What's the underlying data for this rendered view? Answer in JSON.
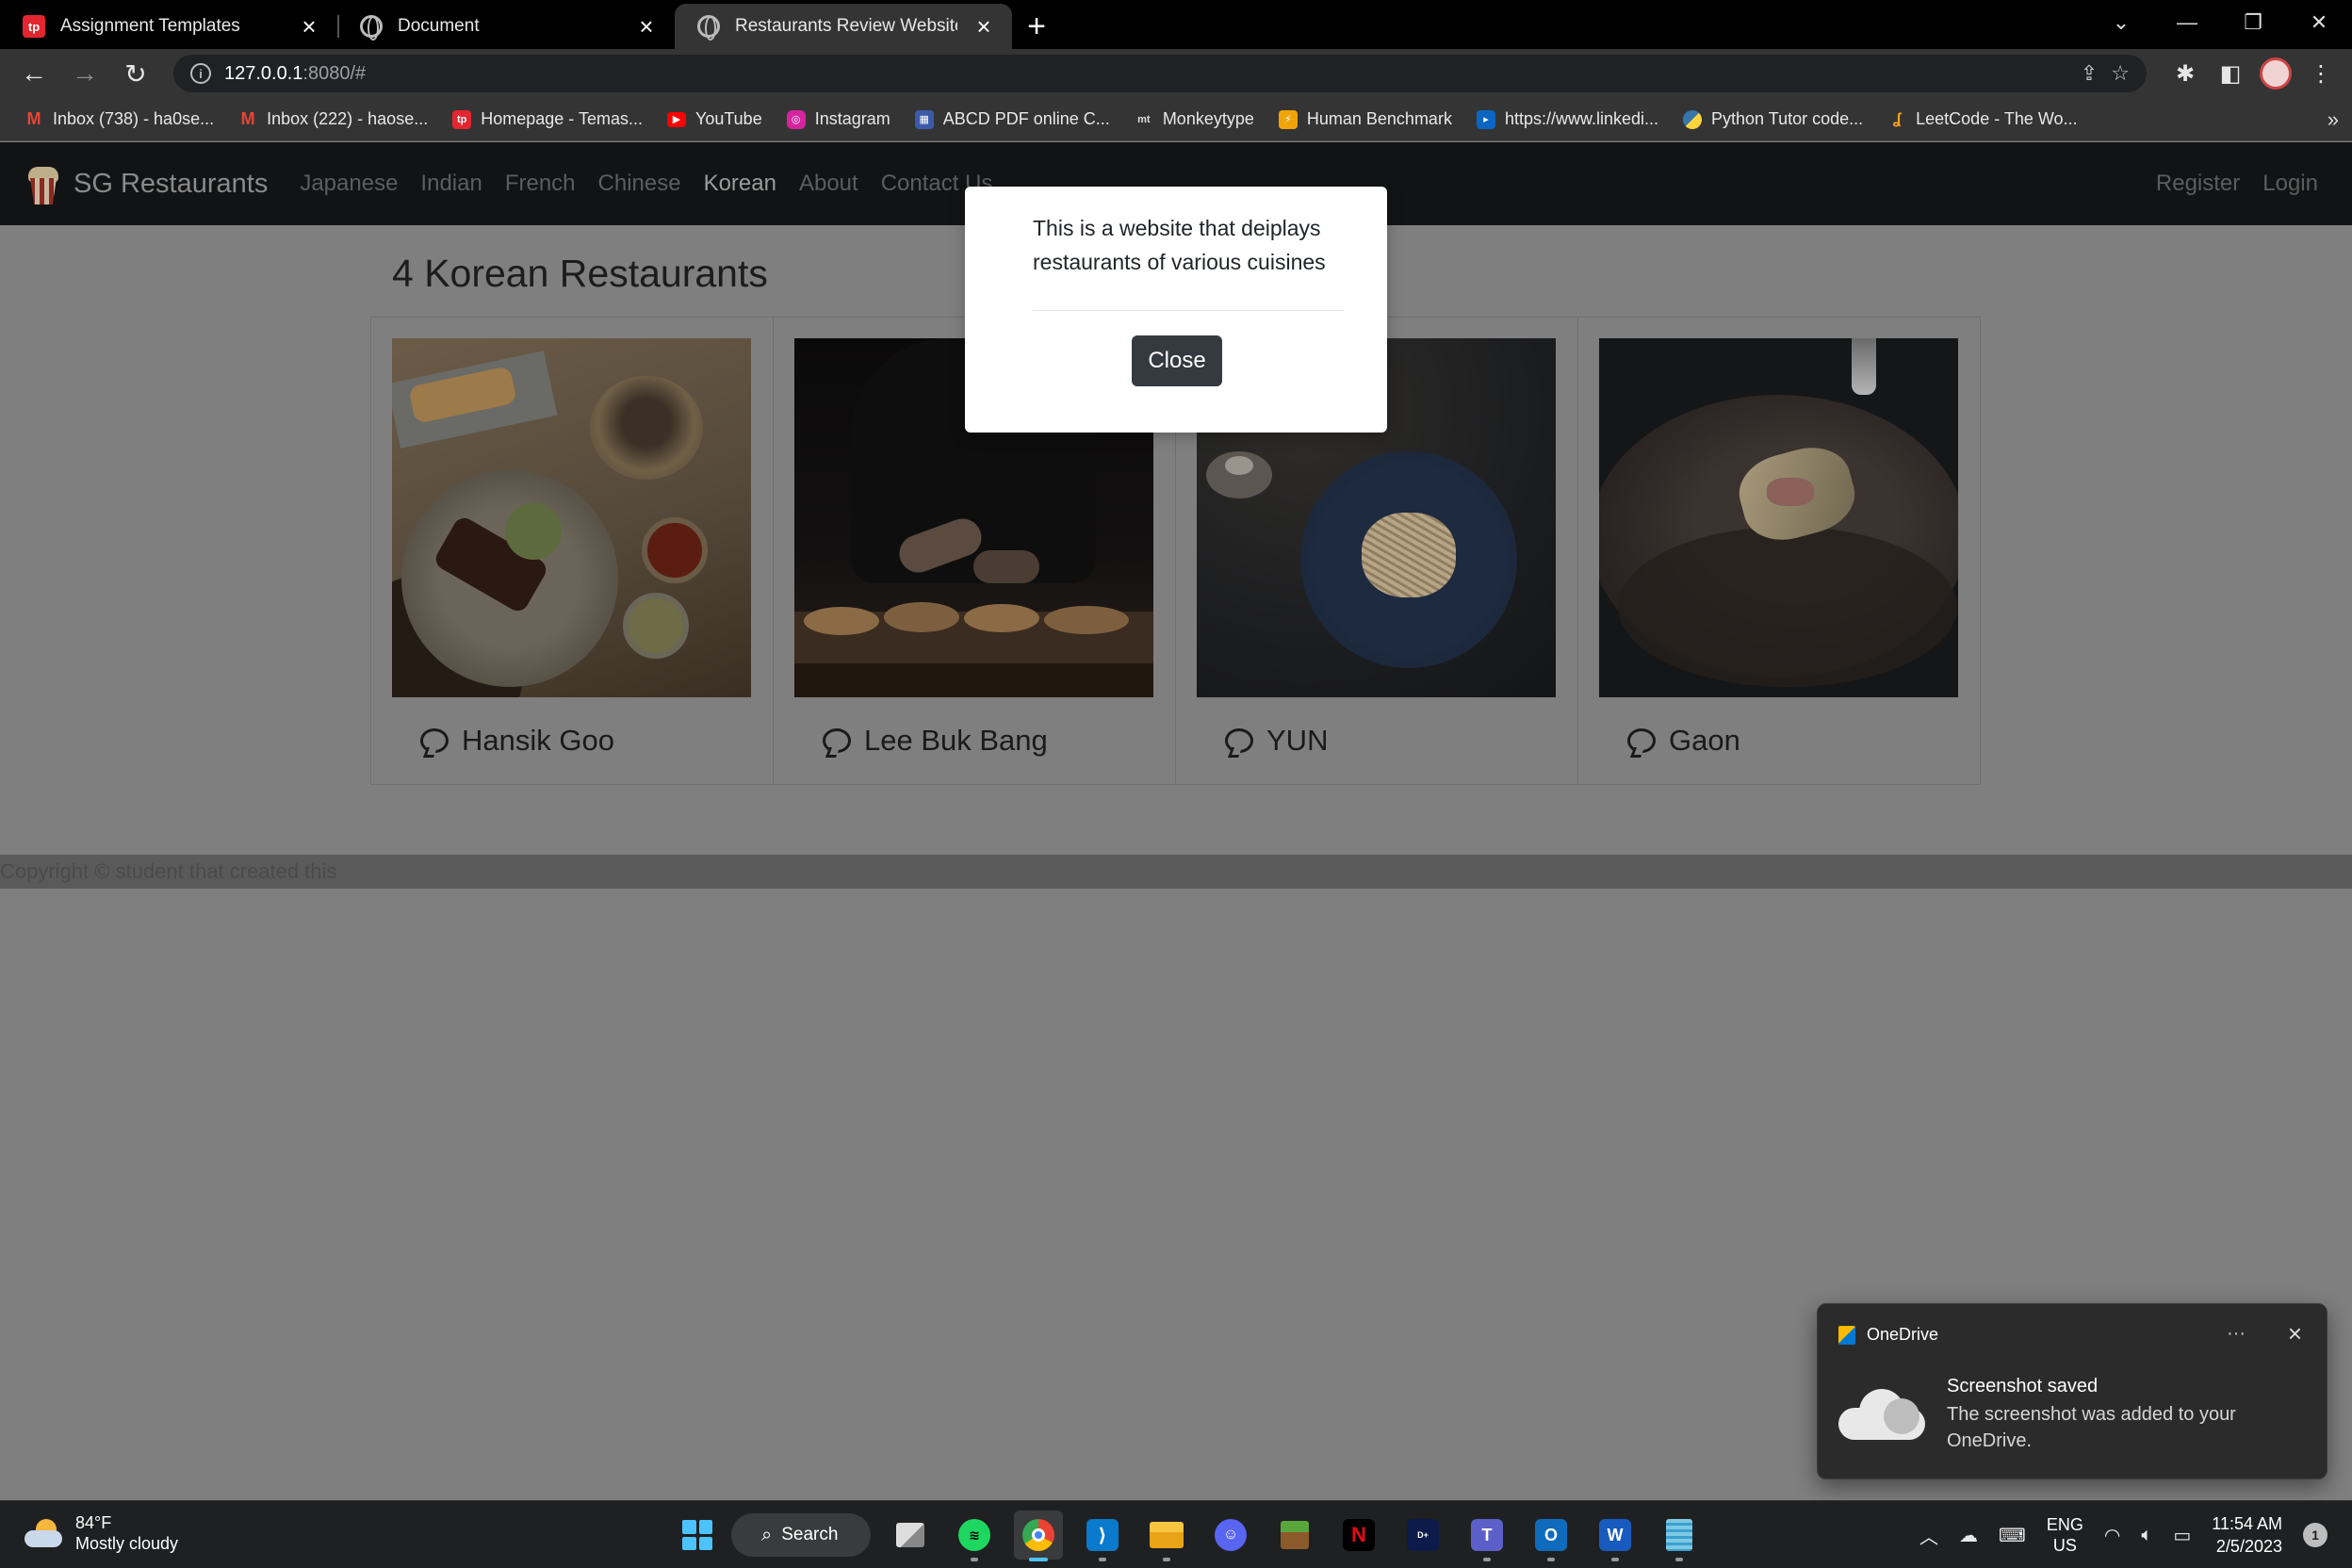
{
  "browser": {
    "tabs": [
      {
        "title": "Assignment Templates",
        "icon": "tp-icon",
        "active": false
      },
      {
        "title": "Document",
        "icon": "globe-icon",
        "active": false
      },
      {
        "title": "Restaurants Review Website",
        "icon": "globe-icon",
        "active": true
      }
    ],
    "url_host": "127.0.0.1",
    "url_path": ":8080/#",
    "bookmarks": [
      {
        "label": "Inbox (738) - ha0se...",
        "icon": "gmail-icon",
        "color": "#ea4335"
      },
      {
        "label": "Inbox (222) - haose...",
        "icon": "gmail-icon",
        "color": "#ea4335"
      },
      {
        "label": "Homepage - Temas...",
        "icon": "tp-icon",
        "color": "#e3262f"
      },
      {
        "label": "YouTube",
        "icon": "youtube-icon",
        "color": "#ff0000"
      },
      {
        "label": "Instagram",
        "icon": "instagram-icon",
        "color": "#d6249f"
      },
      {
        "label": "ABCD PDF online C...",
        "icon": "pdf-icon",
        "color": "#3b5aa8"
      },
      {
        "label": "Monkeytype",
        "icon": "monkeytype-icon",
        "color": "#343434"
      },
      {
        "label": "Human Benchmark",
        "icon": "lightning-icon",
        "color": "#f0a30a"
      },
      {
        "label": "https://www.linkedi...",
        "icon": "linkedin-icon",
        "color": "#0a66c2"
      },
      {
        "label": "Python Tutor code...",
        "icon": "python-icon",
        "color": "#3776ab"
      },
      {
        "label": "LeetCode - The Wo...",
        "icon": "leetcode-icon",
        "color": "#ffa116"
      }
    ],
    "bookmarks_more": "»"
  },
  "site": {
    "brand": "SG Restaurants",
    "nav": [
      {
        "label": "Japanese",
        "active": false
      },
      {
        "label": "Indian",
        "active": false
      },
      {
        "label": "French",
        "active": false
      },
      {
        "label": "Chinese",
        "active": false
      },
      {
        "label": "Korean",
        "active": true
      },
      {
        "label": "About",
        "active": false
      },
      {
        "label": "Contact Us",
        "active": false
      }
    ],
    "register": "Register",
    "login": "Login",
    "heading": "4 Korean Restaurants",
    "restaurants": [
      {
        "name": "Hansik Goo"
      },
      {
        "name": "Lee Buk Bang"
      },
      {
        "name": "YUN"
      },
      {
        "name": "Gaon"
      }
    ],
    "footer": "Copyright © student that created this"
  },
  "modal": {
    "text": "This is a website that deiplays restaurants of various cuisines",
    "close_label": "Close"
  },
  "toast": {
    "app": "OneDrive",
    "more": "···",
    "title": "Screenshot saved",
    "body": "The screenshot was added to your OneDrive."
  },
  "taskbar": {
    "temp": "84°F",
    "weather": "Mostly cloudy",
    "search": "Search",
    "lang1": "ENG",
    "lang2": "US",
    "time": "11:54 AM",
    "date": "2/5/2023",
    "notif_count": "1"
  }
}
